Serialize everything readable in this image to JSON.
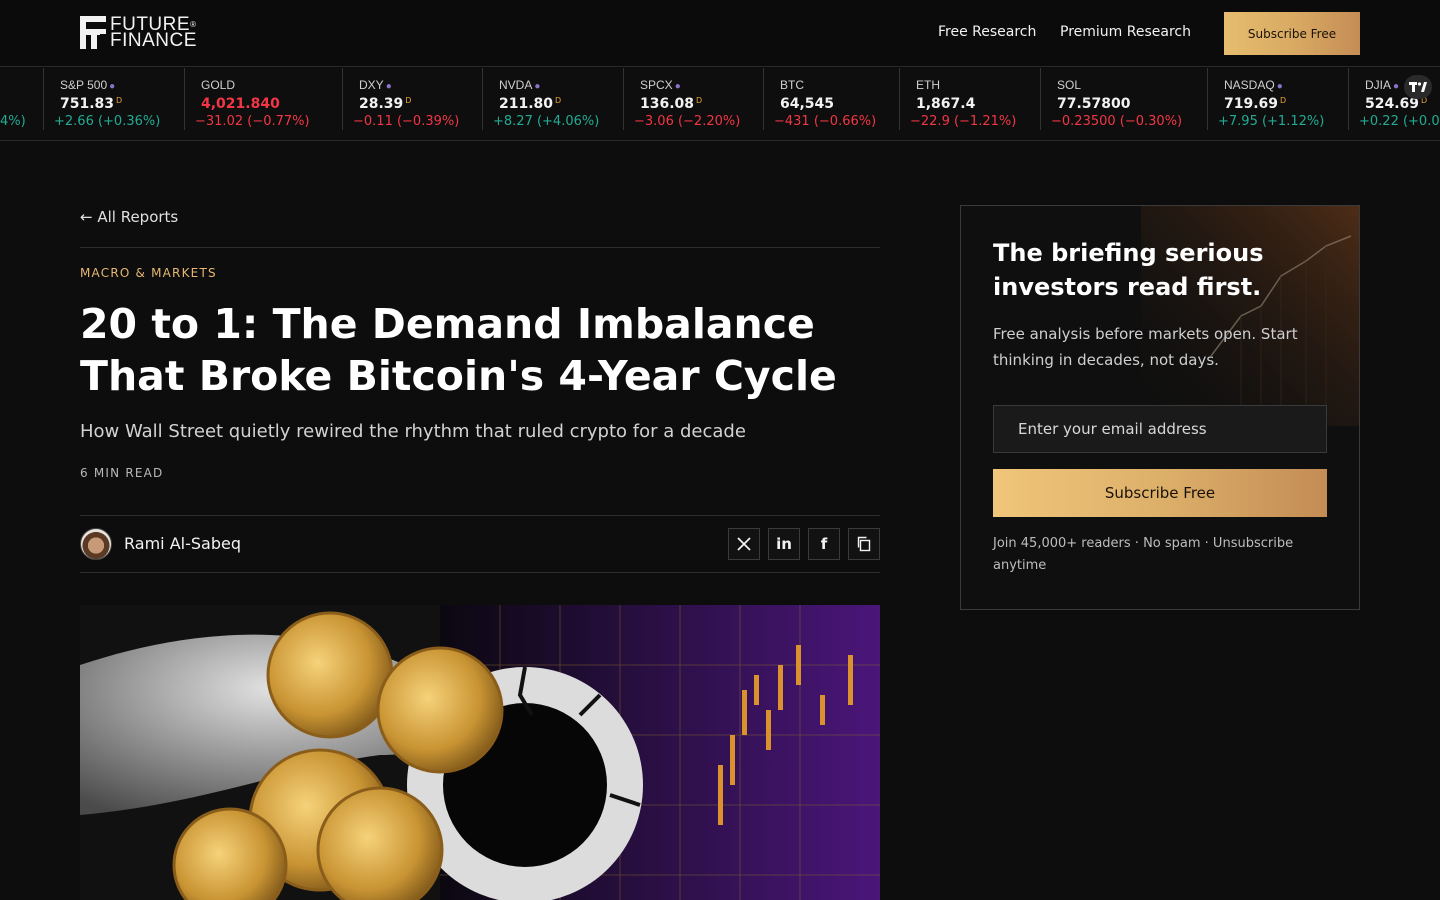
{
  "brand": {
    "line1": "FUTURE",
    "line2": "FINANCE",
    "reg": "®"
  },
  "nav": {
    "free_research": "Free Research",
    "premium_research": "Premium Research",
    "subscribe": "Subscribe Free"
  },
  "ticker": [
    {
      "symbol": "",
      "price": "",
      "change": "4%)",
      "dir": "up"
    },
    {
      "symbol": "S&P 500",
      "price": "751.83",
      "flag": "D",
      "change": "+2.66 (+0.36%)",
      "dir": "up"
    },
    {
      "symbol": "GOLD",
      "price": "4,021.840",
      "flag": "",
      "change": "−31.02 (−0.77%)",
      "dir": "down"
    },
    {
      "symbol": "DXY",
      "price": "28.39",
      "flag": "D",
      "change": "−0.11 (−0.39%)",
      "dir": "down"
    },
    {
      "symbol": "NVDA",
      "price": "211.80",
      "flag": "D",
      "change": "+8.27 (+4.06%)",
      "dir": "up"
    },
    {
      "symbol": "SPCX",
      "price": "136.08",
      "flag": "D",
      "change": "−3.06 (−2.20%)",
      "dir": "down"
    },
    {
      "symbol": "BTC",
      "price": "64,545",
      "flag": "",
      "change": "−431 (−0.66%)",
      "dir": "down"
    },
    {
      "symbol": "ETH",
      "price": "1,867.4",
      "flag": "",
      "change": "−22.9 (−1.21%)",
      "dir": "down"
    },
    {
      "symbol": "SOL",
      "price": "77.57800",
      "flag": "",
      "change": "−0.23500 (−0.30%)",
      "dir": "down"
    },
    {
      "symbol": "NASDAQ",
      "price": "719.69",
      "flag": "D",
      "change": "+7.95 (+1.12%)",
      "dir": "up"
    },
    {
      "symbol": "DJIA",
      "price": "524.69",
      "flag": "D",
      "change": "+0.22 (+0.0",
      "dir": "up"
    }
  ],
  "ticker_badge": "TV",
  "article": {
    "back_link": "← All Reports",
    "category": "MACRO & MARKETS",
    "title": "20 to 1: The Demand Imbalance That Broke Bitcoin's 4-Year Cycle",
    "subtitle": "How Wall Street quietly rewired the rhythm that ruled crypto for a decade",
    "read_time": "6 MIN READ",
    "author": "Rami Al-Sabeq",
    "share": {
      "x": "X",
      "linkedin": "in",
      "facebook": "f"
    }
  },
  "sidebar": {
    "title": "The briefing serious investors read first.",
    "description": "Free analysis before markets open. Start thinking in decades, not days.",
    "email_placeholder": "Enter your email address",
    "button": "Subscribe Free",
    "note": "Join 45,000+ readers · No spam · Unsubscribe anytime"
  },
  "colors": {
    "accent_gold": "#e6b872",
    "up": "#22ab94",
    "down": "#f23645",
    "background": "#0d0d0d"
  },
  "icons": [
    "logo-mark-icon",
    "x-icon",
    "linkedin-icon",
    "facebook-icon",
    "copy-icon",
    "tradingview-icon"
  ]
}
